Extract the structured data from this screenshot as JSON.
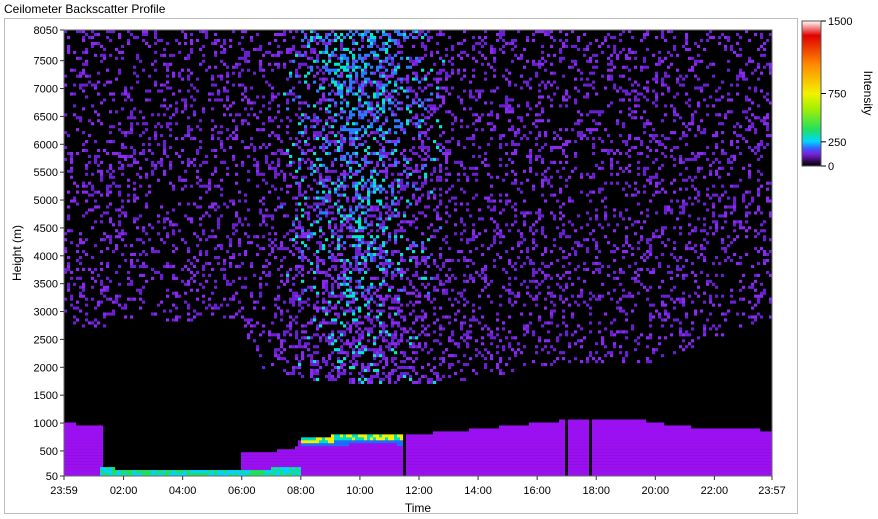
{
  "window_title": "Ceilometer Backscatter Profile",
  "chart_data": {
    "type": "heatmap",
    "title": "Ceilometer Backscatter Profile",
    "xlabel": "Time",
    "ylabel": "Height (m)",
    "x_ticks": [
      "23:59",
      "02:00",
      "04:00",
      "06:00",
      "08:00",
      "10:00",
      "12:00",
      "14:00",
      "16:00",
      "18:00",
      "20:00",
      "22:00",
      "23:57"
    ],
    "x_range_hours": [
      -0.017,
      23.95
    ],
    "y_ticks": [
      50,
      500,
      1000,
      1500,
      2000,
      2500,
      3000,
      3500,
      4000,
      4500,
      5000,
      5500,
      6000,
      6500,
      7000,
      7500,
      8050
    ],
    "ylim": [
      50,
      8050
    ],
    "colorbar": {
      "label": "Intensity",
      "ticks": [
        0,
        250,
        750,
        1500
      ],
      "range": [
        0,
        1500
      ],
      "colors": [
        "#000000",
        "#2a0a4a",
        "#7a1fd6",
        "#3a5cff",
        "#00d6ff",
        "#20e060",
        "#f2f200",
        "#ff8a00",
        "#e00000",
        "#ffffff"
      ]
    },
    "features": {
      "boundary_layer_top_m": [
        [
          -0.017,
          1000
        ],
        [
          1.3,
          950
        ],
        [
          1.3,
          450
        ],
        [
          6,
          470
        ],
        [
          7.8,
          520
        ],
        [
          8,
          750
        ],
        [
          10,
          790
        ],
        [
          11.5,
          780
        ],
        [
          14,
          890
        ],
        [
          16,
          1000
        ],
        [
          17,
          1050
        ],
        [
          18,
          1060
        ],
        [
          19.5,
          1060
        ],
        [
          20.5,
          960
        ],
        [
          22,
          900
        ],
        [
          23.95,
          870
        ]
      ],
      "low_layer_m": [
        [
          -0.017,
          250
        ],
        [
          1.3,
          220
        ],
        [
          2,
          160
        ],
        [
          4,
          150
        ],
        [
          6,
          150
        ],
        [
          7.8,
          210
        ],
        [
          8,
          200
        ],
        [
          9,
          210
        ],
        [
          10,
          230
        ],
        [
          12,
          280
        ],
        [
          14,
          330
        ],
        [
          16,
          380
        ],
        [
          18,
          260
        ],
        [
          20,
          200
        ],
        [
          22,
          180
        ],
        [
          23.95,
          180
        ]
      ],
      "strong_return_band_m": [
        [
          8,
          700
        ],
        [
          9,
          730
        ],
        [
          10,
          760
        ],
        [
          11,
          760
        ],
        [
          11.5,
          740
        ]
      ],
      "noise_top_m": [
        [
          -0.017,
          2700
        ],
        [
          1.3,
          2700
        ],
        [
          1.5,
          2800
        ],
        [
          6,
          2800
        ],
        [
          6.5,
          2000
        ],
        [
          8,
          1800
        ],
        [
          10,
          1700
        ],
        [
          12,
          1700
        ],
        [
          14,
          1800
        ],
        [
          16,
          2000
        ],
        [
          18,
          2100
        ],
        [
          20,
          2100
        ],
        [
          22,
          2500
        ],
        [
          23.95,
          2900
        ]
      ],
      "aerosol_plume": {
        "time_range_hours": [
          6.5,
          18.5
        ],
        "center_hours": 10,
        "max_height_m": 8050
      },
      "vertical_gaps_hours": [
        11.5,
        17.0,
        17.8
      ]
    }
  }
}
